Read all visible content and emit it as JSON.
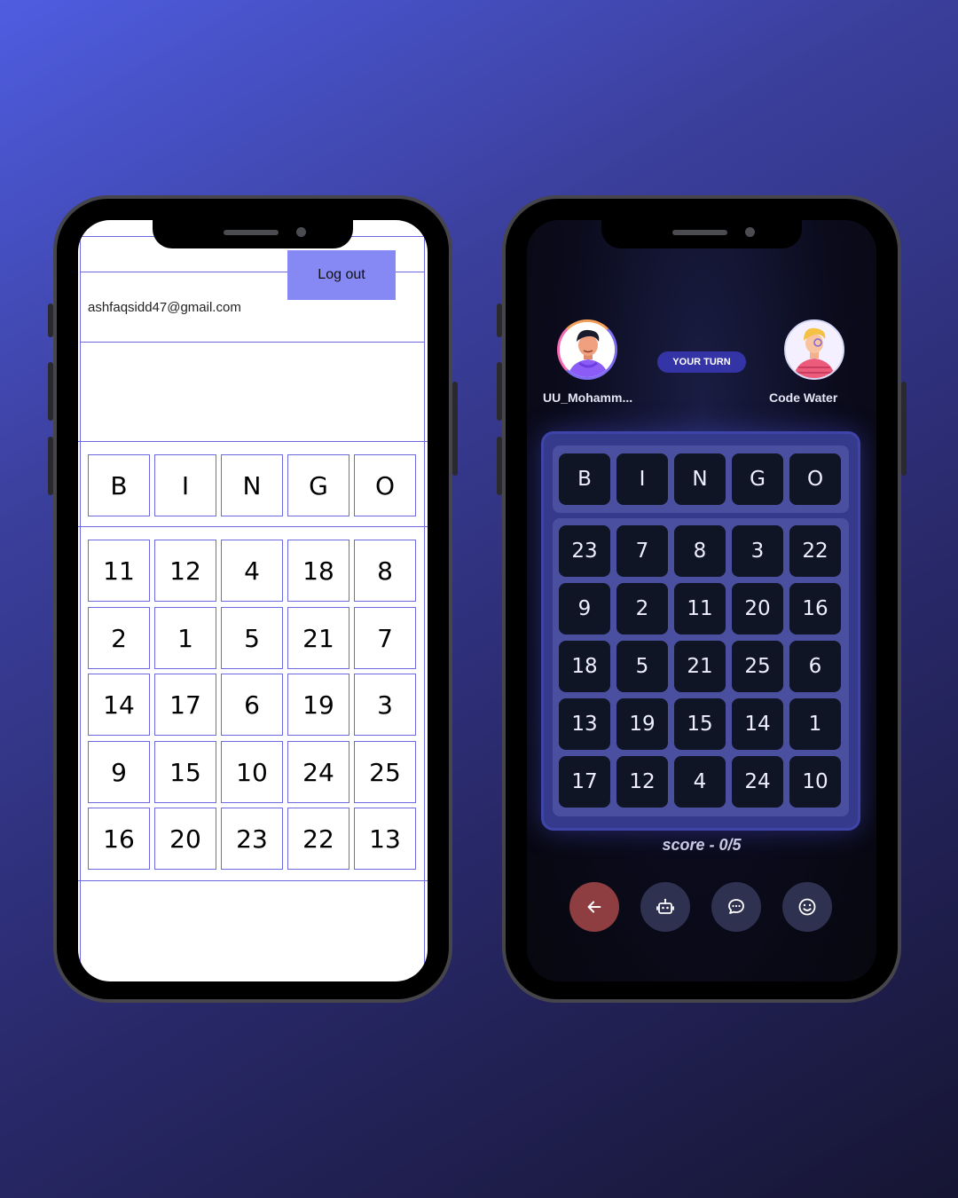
{
  "phone_a": {
    "logout_label": "Log out",
    "email": "ashfaqsidd47@gmail.com",
    "header": [
      "B",
      "I",
      "N",
      "G",
      "O"
    ],
    "grid": [
      [
        "11",
        "12",
        "4",
        "18",
        "8"
      ],
      [
        "2",
        "1",
        "5",
        "21",
        "7"
      ],
      [
        "14",
        "17",
        "6",
        "19",
        "3"
      ],
      [
        "9",
        "15",
        "10",
        "24",
        "25"
      ],
      [
        "16",
        "20",
        "23",
        "22",
        "13"
      ]
    ]
  },
  "phone_b": {
    "player1": {
      "name": "UU_Mohamm...",
      "avatar": "person-avatar-icon"
    },
    "player2": {
      "name": "Code Water",
      "avatar": "person-avatar-icon"
    },
    "turn_badge": "YOUR TURN",
    "header": [
      "B",
      "I",
      "N",
      "G",
      "O"
    ],
    "grid": [
      [
        "23",
        "7",
        "8",
        "3",
        "22"
      ],
      [
        "9",
        "2",
        "11",
        "20",
        "16"
      ],
      [
        "18",
        "5",
        "21",
        "25",
        "6"
      ],
      [
        "13",
        "19",
        "15",
        "14",
        "1"
      ],
      [
        "17",
        "12",
        "4",
        "24",
        "10"
      ]
    ],
    "score": "score - 0/5",
    "actions": [
      "arrow-left-icon",
      "robot-icon",
      "chat-icon",
      "smiley-icon"
    ],
    "colors": {
      "back_button": "#8e3e40",
      "action_button": "#2f3150",
      "cell": "#0f1525",
      "board": "#4a4fa0"
    }
  }
}
